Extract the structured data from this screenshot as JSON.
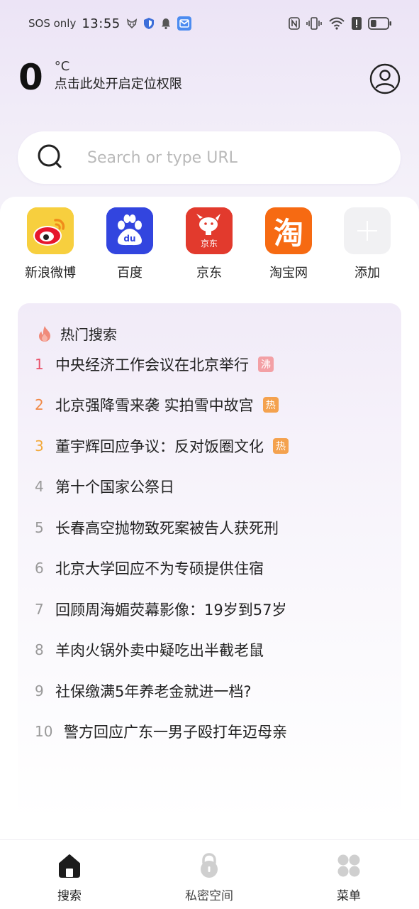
{
  "status_bar": {
    "carrier": "SOS only",
    "time": "13:55",
    "icons": [
      "fox-icon",
      "shield-icon",
      "bell-icon",
      "message-app-icon",
      "nfc-icon",
      "vibrate-icon",
      "wifi-icon",
      "alert-icon",
      "battery-icon"
    ],
    "battery_level": 0.35
  },
  "weather": {
    "temperature": "0",
    "unit": "°C",
    "location_tip": "点击此处开启定位权限"
  },
  "search": {
    "placeholder": "Search or type URL"
  },
  "shortcuts": [
    {
      "label": "新浪微博",
      "icon": "weibo-icon",
      "color": "#f7cf3e"
    },
    {
      "label": "百度",
      "icon": "baidu-icon",
      "color": "#3245df"
    },
    {
      "label": "京东",
      "icon": "jd-icon",
      "color": "#e23a2d",
      "sublabel": "京东"
    },
    {
      "label": "淘宝网",
      "icon": "taobao-icon",
      "color": "#f66a12",
      "glyph": "淘"
    },
    {
      "label": "添加",
      "icon": "add-icon",
      "color": "#f1f1f3"
    }
  ],
  "hot_search": {
    "title": "热门搜索",
    "items": [
      {
        "rank": "1",
        "text": "中央经济工作会议在北京举行",
        "badge": "沸",
        "badge_color": "#f3a0a5"
      },
      {
        "rank": "2",
        "text": "北京强降雪来袭 实拍雪中故宫",
        "badge": "热",
        "badge_color": "#f4a24e"
      },
      {
        "rank": "3",
        "text": "董宇辉回应争议：反对饭圈文化",
        "badge": "热",
        "badge_color": "#f4a24e"
      },
      {
        "rank": "4",
        "text": "第十个国家公祭日"
      },
      {
        "rank": "5",
        "text": "长春高空抛物致死案被告人获死刑"
      },
      {
        "rank": "6",
        "text": "北京大学回应不为专硕提供住宿"
      },
      {
        "rank": "7",
        "text": "回顾周海媚荧幕影像：19岁到57岁"
      },
      {
        "rank": "8",
        "text": "羊肉火锅外卖中疑吃出半截老鼠"
      },
      {
        "rank": "9",
        "text": "社保缴满5年养老金就进一档?"
      },
      {
        "rank": "10",
        "text": "警方回应广东一男子殴打年迈母亲"
      }
    ]
  },
  "bottom_nav": {
    "items": [
      {
        "label": "搜索",
        "icon": "home-icon",
        "active": true
      },
      {
        "label": "私密空间",
        "icon": "lock-icon",
        "active": false
      },
      {
        "label": "菜单",
        "icon": "menu-grid-icon",
        "active": false
      }
    ]
  }
}
